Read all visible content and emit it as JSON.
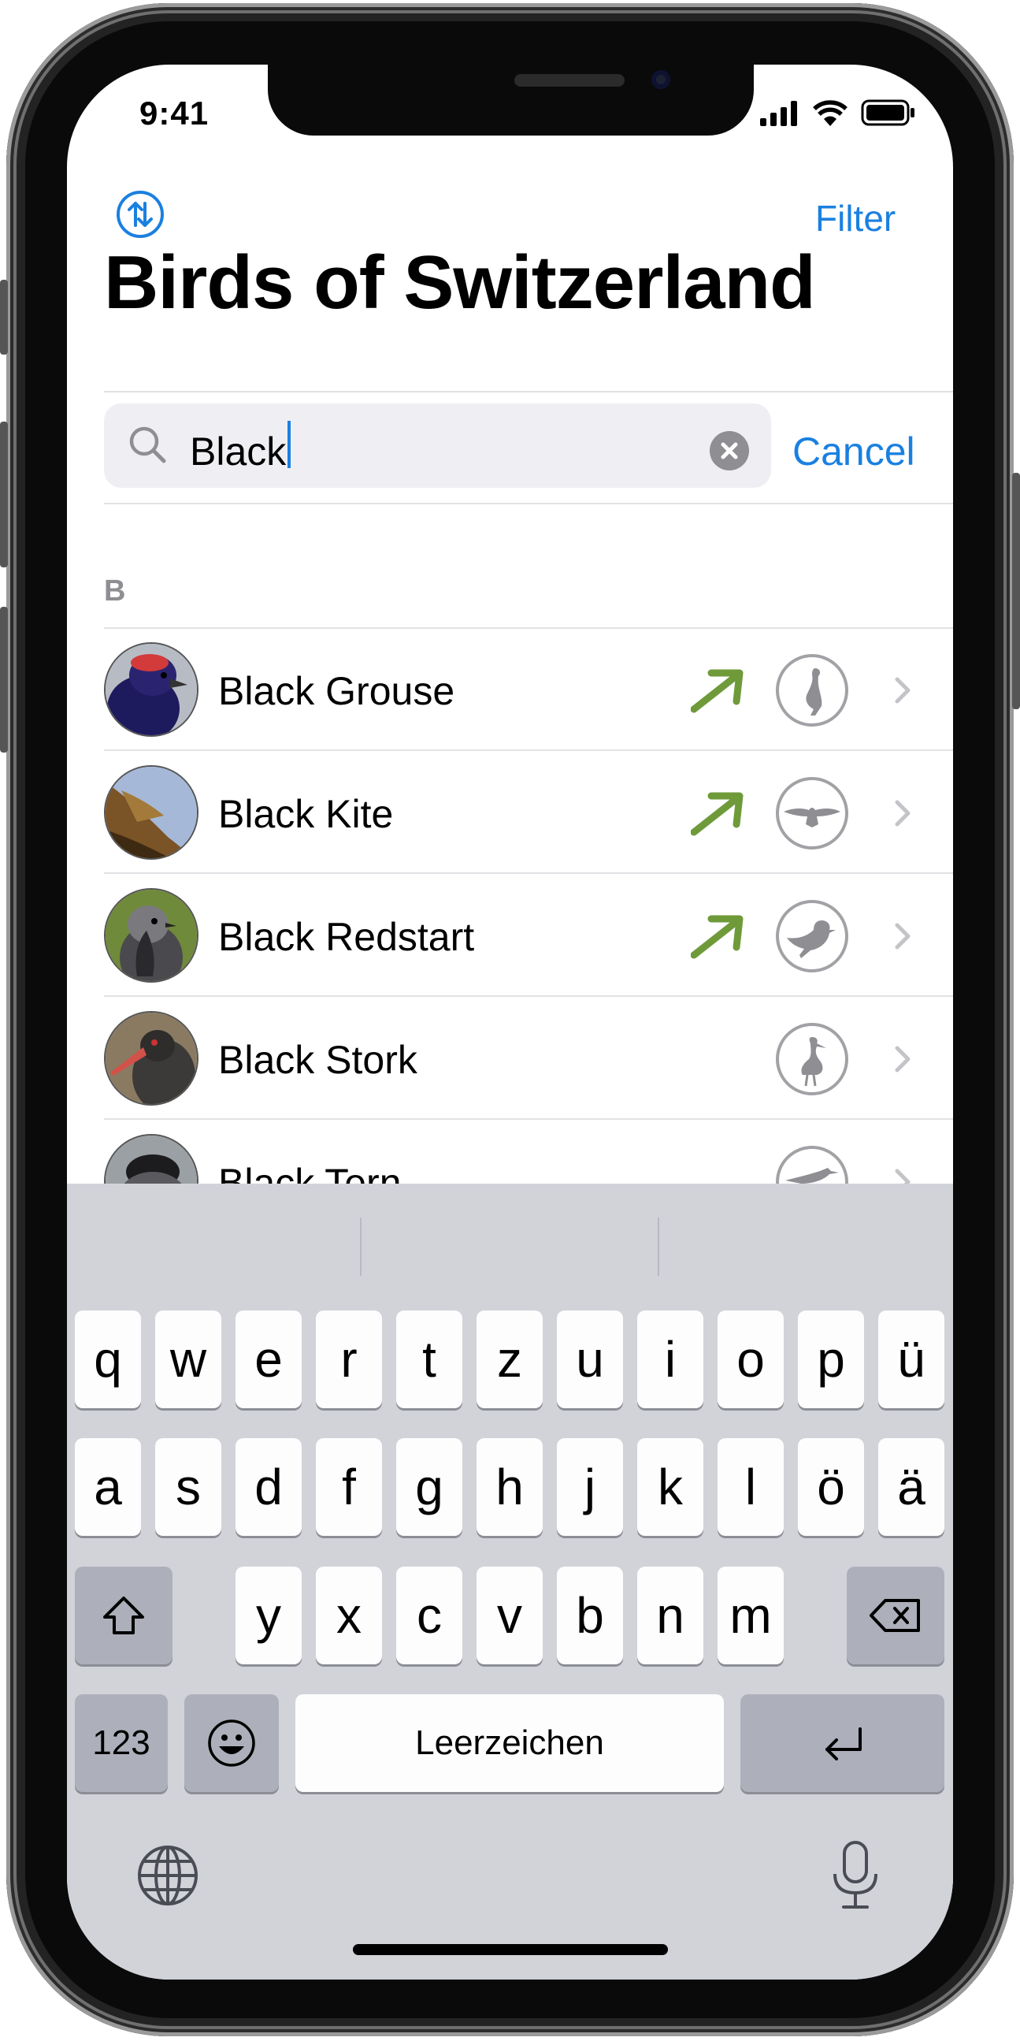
{
  "status_bar": {
    "time": "9:41"
  },
  "nav": {
    "sort_icon": "sort-arrows-icon",
    "filter_label": "Filter"
  },
  "title": "Birds of Switzerland",
  "search": {
    "value": "Black",
    "cancel_label": "Cancel"
  },
  "section": {
    "header": "B"
  },
  "list": [
    {
      "name": "Black Grouse",
      "trend": "up",
      "silhouette": "grouse-silhouette-icon"
    },
    {
      "name": "Black Kite",
      "trend": "up",
      "silhouette": "raptor-silhouette-icon"
    },
    {
      "name": "Black Redstart",
      "trend": "up",
      "silhouette": "songbird-silhouette-icon"
    },
    {
      "name": "Black Stork",
      "trend": "none",
      "silhouette": "stork-silhouette-icon"
    },
    {
      "name": "Black Tern",
      "trend": "none",
      "silhouette": "tern-silhouette-icon"
    }
  ],
  "keyboard": {
    "row1": [
      "q",
      "w",
      "e",
      "r",
      "t",
      "z",
      "u",
      "i",
      "o",
      "p",
      "ü"
    ],
    "row2": [
      "a",
      "s",
      "d",
      "f",
      "g",
      "h",
      "j",
      "k",
      "l",
      "ö",
      "ä"
    ],
    "row3": [
      "y",
      "x",
      "c",
      "v",
      "b",
      "n",
      "m"
    ],
    "numbers_label": "123",
    "space_label": "Leerzeichen"
  },
  "colors": {
    "accent": "#1A80E0",
    "trend_green": "#6F9A3A",
    "keyboard_bg": "#D1D3D9"
  }
}
